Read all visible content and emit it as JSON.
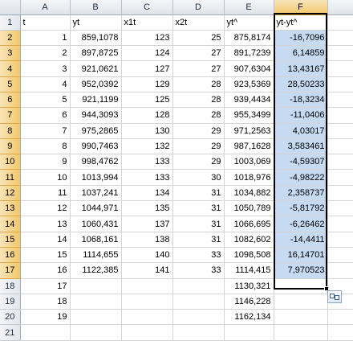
{
  "columns": [
    "A",
    "B",
    "C",
    "D",
    "E",
    "F"
  ],
  "selected_column": "F",
  "rows": [
    {
      "n": "1",
      "a": "t",
      "b": "yt",
      "c": "x1t",
      "d": "x2t",
      "e": "yt^",
      "f": "yt-yt^"
    },
    {
      "n": "2",
      "a": "1",
      "b": "859,1078",
      "c": "123",
      "d": "25",
      "e": "875,8174",
      "f": "-16,7096"
    },
    {
      "n": "3",
      "a": "2",
      "b": "897,8725",
      "c": "124",
      "d": "27",
      "e": "891,7239",
      "f": "6,14859"
    },
    {
      "n": "4",
      "a": "3",
      "b": "921,0621",
      "c": "127",
      "d": "27",
      "e": "907,6304",
      "f": "13,43167"
    },
    {
      "n": "5",
      "a": "4",
      "b": "952,0392",
      "c": "129",
      "d": "28",
      "e": "923,5369",
      "f": "28,50233"
    },
    {
      "n": "6",
      "a": "5",
      "b": "921,1199",
      "c": "125",
      "d": "28",
      "e": "939,4434",
      "f": "-18,3234"
    },
    {
      "n": "7",
      "a": "6",
      "b": "944,3093",
      "c": "128",
      "d": "28",
      "e": "955,3499",
      "f": "-11,0406"
    },
    {
      "n": "8",
      "a": "7",
      "b": "975,2865",
      "c": "130",
      "d": "29",
      "e": "971,2563",
      "f": "4,03017"
    },
    {
      "n": "9",
      "a": "8",
      "b": "990,7463",
      "c": "132",
      "d": "29",
      "e": "987,1628",
      "f": "3,583461"
    },
    {
      "n": "10",
      "a": "9",
      "b": "998,4762",
      "c": "133",
      "d": "29",
      "e": "1003,069",
      "f": "-4,59307"
    },
    {
      "n": "11",
      "a": "10",
      "b": "1013,994",
      "c": "133",
      "d": "30",
      "e": "1018,976",
      "f": "-4,98222"
    },
    {
      "n": "12",
      "a": "11",
      "b": "1037,241",
      "c": "134",
      "d": "31",
      "e": "1034,882",
      "f": "2,358737"
    },
    {
      "n": "13",
      "a": "12",
      "b": "1044,971",
      "c": "135",
      "d": "31",
      "e": "1050,789",
      "f": "-5,81792"
    },
    {
      "n": "14",
      "a": "13",
      "b": "1060,431",
      "c": "137",
      "d": "31",
      "e": "1066,695",
      "f": "-6,26462"
    },
    {
      "n": "15",
      "a": "14",
      "b": "1068,161",
      "c": "138",
      "d": "31",
      "e": "1082,602",
      "f": "-14,4411"
    },
    {
      "n": "16",
      "a": "15",
      "b": "1114,655",
      "c": "140",
      "d": "33",
      "e": "1098,508",
      "f": "16,14701"
    },
    {
      "n": "17",
      "a": "16",
      "b": "1122,385",
      "c": "141",
      "d": "33",
      "e": "1114,415",
      "f": "7,970523"
    },
    {
      "n": "18",
      "a": "17",
      "b": "",
      "c": "",
      "d": "",
      "e": "1130,321",
      "f": ""
    },
    {
      "n": "19",
      "a": "18",
      "b": "",
      "c": "",
      "d": "",
      "e": "1146,228",
      "f": ""
    },
    {
      "n": "20",
      "a": "19",
      "b": "",
      "c": "",
      "d": "",
      "e": "1162,134",
      "f": ""
    },
    {
      "n": "21",
      "a": "",
      "b": "",
      "c": "",
      "d": "",
      "e": "",
      "f": ""
    }
  ],
  "selection": {
    "column": "F",
    "first_row": "1",
    "last_row": "17",
    "active_cell": "F1"
  },
  "colors": {
    "selection_fill": "#c6daf2",
    "header_selected": "#f2c76a",
    "gridline": "#d4d4d4"
  },
  "icons": {
    "paste_options": "paste-options-icon"
  }
}
